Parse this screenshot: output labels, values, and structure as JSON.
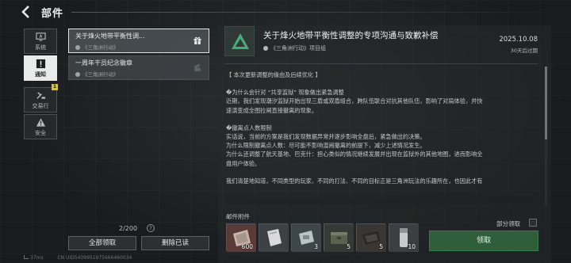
{
  "header": {
    "title": "部件"
  },
  "categories": [
    {
      "label": "系统",
      "icon": "monitor-icon"
    },
    {
      "label": "通知",
      "icon": "exclamation-icon",
      "active": true
    },
    {
      "label": "交易行",
      "icon": "hammer-icon",
      "badge": "1"
    },
    {
      "label": "安全",
      "icon": "warning-icon"
    }
  ],
  "mail_list": [
    {
      "title": "关于烽火地带平衡性调...",
      "sender": "《三角洲行动》",
      "icon": "gift-icon",
      "selected": true
    },
    {
      "title": "一周年干员纪念徽章",
      "sender": "《三角洲行动》",
      "icon": "gift-opened-icon",
      "selected": false
    }
  ],
  "list_footer": {
    "count": "2/200",
    "help": "?",
    "claim_all": "全部领取",
    "delete_read": "删除已读"
  },
  "status_bar": {
    "ping": "37ms",
    "uid": "CN UID5409951975666460034"
  },
  "detail": {
    "title": "关于烽火地带平衡性调整的专项沟通与致歉补偿",
    "sender": "《三角洲行动》项目组",
    "date": "2025.10.08",
    "expires": "30天后过期",
    "body": [
      "【 本次更新调整的缘由及后续优化 】",
      "",
      "�为什么会针对 “共享监狱” 现象做出紧急调整",
      "近期，我们发现潮汐监狱开始出现三盾或双盾组合，跨队伍联合对抗其他队伍，影响了对局体验，并快",
      "速演变成全图拉闸直接撤离的现象。",
      "",
      "�撤离点人数限制",
      "实话说，当前的方案是我们发现数据异常并逐步影响全盘后，紧急做出的决策。",
      "为什么限制撤离点人数：尽可能不影响混闹撤离的前提下，减少上述情况发生。",
      "为什么还调整了航天基地、巴克什：担心类似的情况继续发展并出现在监狱外的其他地图，进而影响全",
      "盘用户体验。",
      "",
      "我们清楚地知道，不同类型的玩家、不同的打法、不同的目标正是三角洲玩法的乐趣所在，也因此才有"
    ]
  },
  "attachments": {
    "label": "邮件附件",
    "partial_label": "部分领取",
    "claim_label": "领取",
    "items": [
      {
        "name": "currency-bag-icon",
        "qty": "600"
      },
      {
        "name": "supply-box-icon",
        "qty": ""
      },
      {
        "name": "key-card-icon",
        "qty": "3"
      },
      {
        "name": "ammo-case-icon",
        "qty": "5"
      },
      {
        "name": "armor-plate-icon",
        "qty": "5"
      },
      {
        "name": "medkit-icon",
        "qty": "10"
      }
    ]
  }
}
